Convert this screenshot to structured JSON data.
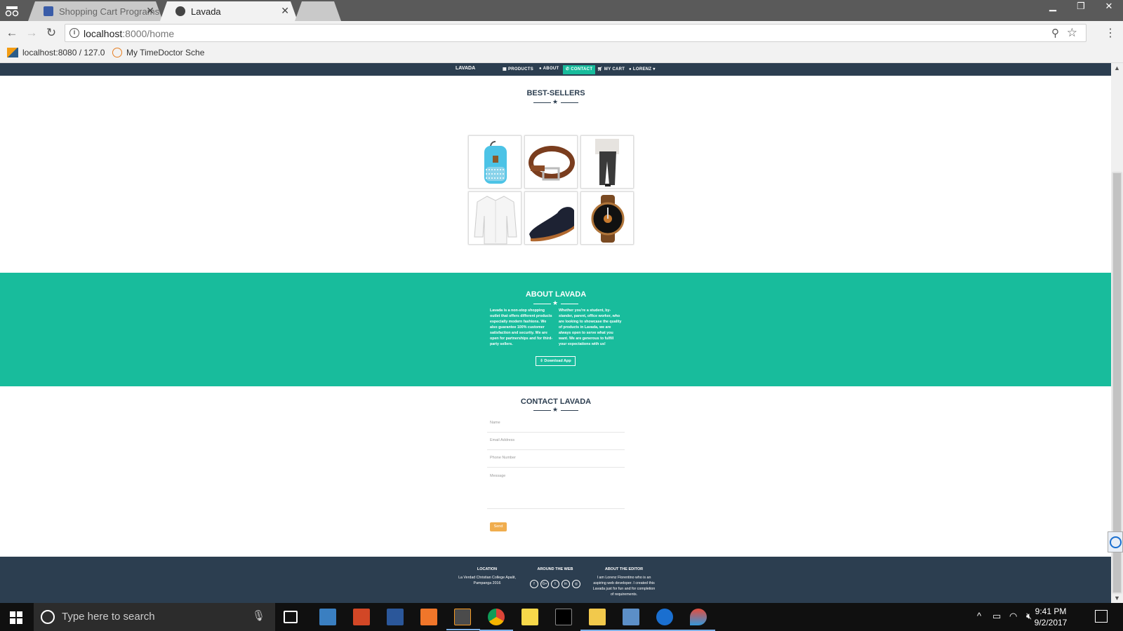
{
  "browser": {
    "tabs": [
      {
        "title": "Shopping Cart Programs",
        "active": false
      },
      {
        "title": "Lavada",
        "active": true
      }
    ],
    "url_host": "localhost",
    "url_rest": ":8000/home",
    "bookmarks": [
      {
        "label": "localhost:8080 / 127.0"
      },
      {
        "label": "My TimeDoctor Sche"
      }
    ]
  },
  "site": {
    "brand": "LAVADA",
    "nav": [
      {
        "label": "PRODUCTS",
        "icon": "grid-icon"
      },
      {
        "label": "ABOUT",
        "icon": "info-icon"
      },
      {
        "label": "CONTACT",
        "icon": "phone-icon",
        "active": true
      },
      {
        "label": "MY CART",
        "icon": "cart-icon"
      },
      {
        "label": "LORENZ",
        "icon": "user-icon"
      }
    ],
    "bestsellers": {
      "title": "BEST-SELLERS",
      "products": [
        "backpack",
        "belt",
        "pants",
        "shirt",
        "shoe",
        "watch"
      ]
    },
    "about": {
      "title": "ABOUT LAVADA",
      "left_text": "Lavada is a non-stop shopping outlet that offers different products especially modern fashions. We also guarantee 100% customer satisfaction and security. We are open for partnerships and for third-party sellers.",
      "right_text": "Whether you're a student, by-stander, parent, office worker, who are looking to showcase the quality of products in Lavada, we are always open to serve what you want. We are generous to fulfill your expectations with us!",
      "download_label": "Download App"
    },
    "contact": {
      "title": "CONTACT LAVADA",
      "name_placeholder": "Name",
      "email_placeholder": "Email Address",
      "phone_placeholder": "Phone Number",
      "message_placeholder": "Message",
      "send_label": "Send"
    },
    "footer": {
      "location_title": "LOCATION",
      "location_text": "La Verdad Christian College Apalit, Pampanga 2016",
      "web_title": "AROUND THE WEB",
      "social": [
        "f",
        "G+",
        "t",
        "in",
        "◎"
      ],
      "editor_title": "ABOUT THE EDITOR",
      "editor_text": "I am Lorenz Florentino who is an aspiring web developer. I created this Lavada just for fun and for completion of requirements."
    }
  },
  "taskbar": {
    "search_placeholder": "Type here to search",
    "time": "9:41 PM",
    "date": "9/2/2017"
  }
}
